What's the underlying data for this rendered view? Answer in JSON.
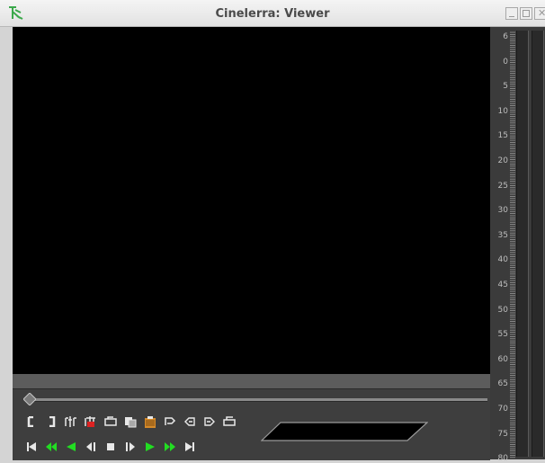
{
  "window": {
    "title": "Cinelerra: Viewer"
  },
  "icons": {
    "app": "cinelerra-app-icon",
    "minimize": "minimize-icon",
    "maximize": "maximize-icon",
    "close": "close-icon"
  },
  "timeline_slider": {
    "position": 0.0
  },
  "edit_toolbar": {
    "buttons": [
      {
        "name": "in-point",
        "icon": "in-point-icon"
      },
      {
        "name": "out-point",
        "icon": "out-point-icon"
      },
      {
        "name": "splice",
        "icon": "splice-icon"
      },
      {
        "name": "overwrite",
        "icon": "overwrite-icon"
      },
      {
        "name": "to-clip",
        "icon": "to-clip-icon"
      },
      {
        "name": "copy",
        "icon": "copy-icon"
      },
      {
        "name": "paste",
        "icon": "paste-icon"
      },
      {
        "name": "label",
        "icon": "label-icon"
      },
      {
        "name": "prev-label",
        "icon": "prev-label-icon"
      },
      {
        "name": "next-label",
        "icon": "next-label-icon"
      },
      {
        "name": "undo",
        "icon": "undo-icon"
      }
    ]
  },
  "transport": {
    "buttons": [
      {
        "name": "rewind-to-start",
        "icon": "skip-back-icon"
      },
      {
        "name": "fast-reverse",
        "icon": "fast-reverse-icon"
      },
      {
        "name": "reverse-play",
        "icon": "reverse-play-icon"
      },
      {
        "name": "frame-back",
        "icon": "frame-back-icon"
      },
      {
        "name": "stop",
        "icon": "stop-icon"
      },
      {
        "name": "frame-forward",
        "icon": "frame-forward-icon"
      },
      {
        "name": "play",
        "icon": "play-icon"
      },
      {
        "name": "fast-forward",
        "icon": "fast-forward-icon"
      },
      {
        "name": "end",
        "icon": "skip-forward-icon"
      }
    ]
  },
  "meter": {
    "scale_labels": [
      "6",
      "0",
      "5",
      "10",
      "15",
      "20",
      "25",
      "30",
      "35",
      "40",
      "45",
      "50",
      "55",
      "60",
      "65",
      "70",
      "75",
      "80"
    ]
  },
  "colors": {
    "canvas": "#000000",
    "panel": "#3b3b3b",
    "transport_green": "#22dd22",
    "accent_red": "#dd2222",
    "accent_orange": "#d58a2a"
  }
}
